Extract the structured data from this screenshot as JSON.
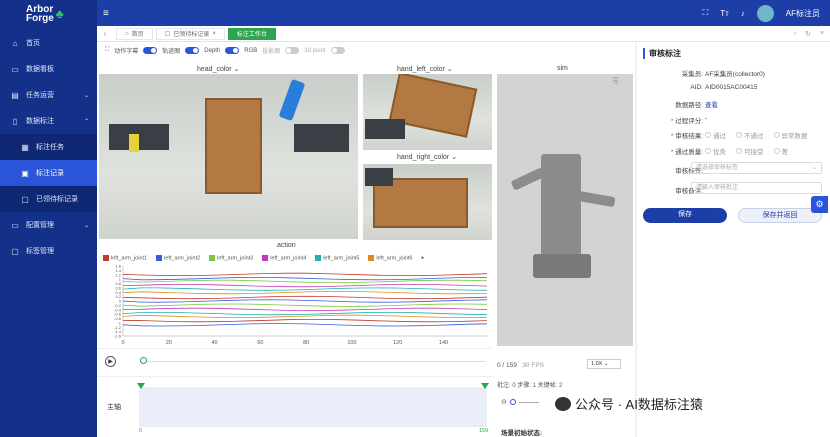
{
  "app": {
    "logo_line1": "Arbor",
    "logo_line2": "Forge",
    "user": "AF标注员"
  },
  "sidebar": {
    "items": [
      {
        "label": "首页",
        "icon": "home-icon"
      },
      {
        "label": "数据看板",
        "icon": "dashboard-icon"
      },
      {
        "label": "任务运营",
        "icon": "task-icon"
      },
      {
        "label": "数据标注",
        "icon": "doc-icon"
      },
      {
        "label": "标注任务",
        "icon": "grid-icon"
      },
      {
        "label": "标注记录",
        "icon": "record-icon"
      },
      {
        "label": "已领待标记录",
        "icon": "bookmark-icon"
      },
      {
        "label": "配置管理",
        "icon": "monitor-icon"
      },
      {
        "label": "标签管理",
        "icon": "tag-icon"
      }
    ]
  },
  "tabs": [
    {
      "label": "首页"
    },
    {
      "label": "已领待标记录"
    },
    {
      "label": "标注工作台"
    }
  ],
  "toggles": {
    "subtitle": "动作字幕",
    "trajectory": "轨迹图",
    "depth": "Depth",
    "rgb": "RGB",
    "projection": "投影图",
    "point3d": "3d point"
  },
  "views": {
    "head": "head_color",
    "left": "hand_left_color",
    "right": "hand_right_color",
    "sim": "sim"
  },
  "chart_data": {
    "type": "line",
    "title": "action",
    "series": [
      {
        "name": "left_arm_joint1",
        "color": "#c0392b"
      },
      {
        "name": "left_arm_joint2",
        "color": "#3b5bdb"
      },
      {
        "name": "left_arm_joint3",
        "color": "#7cc63a"
      },
      {
        "name": "left_arm_joint4",
        "color": "#c03bb8"
      },
      {
        "name": "left_arm_joint5",
        "color": "#20b2aa"
      },
      {
        "name": "left_arm_joint6",
        "color": "#e08a1e"
      }
    ],
    "x_ticks": [
      "0",
      "20",
      "40",
      "60",
      "80",
      "100",
      "120",
      "140"
    ],
    "y_ticks": [
      "1.6",
      "1.4",
      "1.2",
      "1",
      "0.8",
      "0.6",
      "0.4",
      "0.2",
      "0",
      "-0.2",
      "-0.4",
      "-0.6",
      "-0.8",
      "-1",
      "-1.2",
      "-1.4",
      "-1.6"
    ],
    "xlim": [
      0,
      159
    ]
  },
  "timeline": {
    "label": "主轴",
    "start": "0",
    "end": "159"
  },
  "playback": {
    "frame": "0 / 159",
    "fps": "30 FPS",
    "speed": "1.0X"
  },
  "stats": {
    "text": "批注: 0   步骤: 1   关键帧: 2"
  },
  "init_state": "场景初始状态:",
  "review": {
    "title": "审核标注",
    "collector_label": "采集员:",
    "collector": "AF采集员(collector0)",
    "aid_label": "AID:",
    "aid": "AID0015AC00415",
    "path_label": "数据路径:",
    "path": "查看",
    "score_label": "过程评分:",
    "score": "-",
    "result_label": "审核结果:",
    "result_opts": [
      "通过",
      "不通过",
      "异常数据"
    ],
    "quality_label": "通过质量:",
    "quality_opts": [
      "优秀",
      "可接受",
      "差"
    ],
    "tag_label": "审核标签:",
    "tag_placeholder": "请选择审核标签",
    "note_label": "审核备注:",
    "note_placeholder": "请输入审核批注",
    "save": "保存",
    "save_return": "保存并返回"
  },
  "watermark": "公众号 · AI数据标注猿"
}
